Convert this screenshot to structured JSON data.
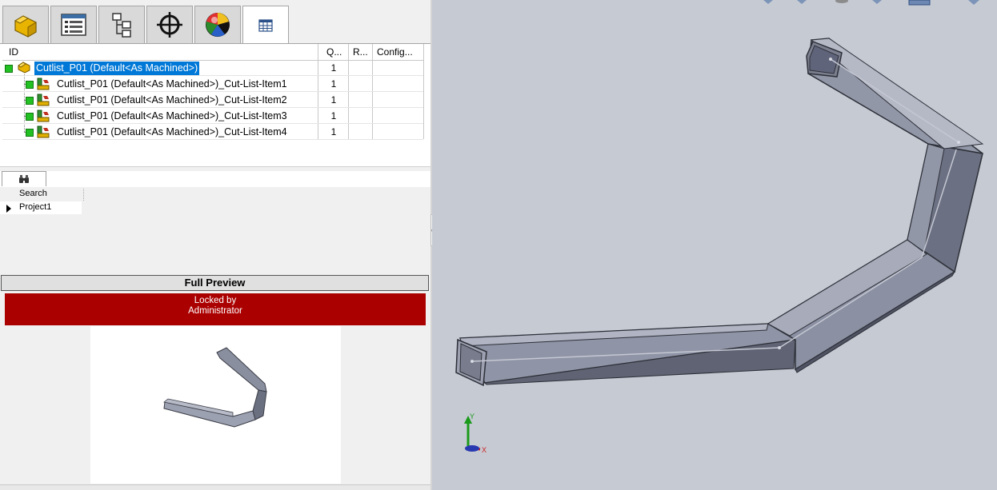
{
  "tabs": [
    {
      "name": "part-icon",
      "active": false
    },
    {
      "name": "property-list-icon",
      "active": false
    },
    {
      "name": "tree-structure-icon",
      "active": false
    },
    {
      "name": "target-crosshair-icon",
      "active": false
    },
    {
      "name": "appearance-sphere-icon",
      "active": false
    },
    {
      "name": "grid-table-icon",
      "active": true
    }
  ],
  "cutlist": {
    "columns": {
      "id": "ID",
      "qty": "Q...",
      "r": "R...",
      "config": "Config..."
    },
    "rows": [
      {
        "label": "Cutlist_P01 (Default<As Machined>)",
        "qty": "1",
        "selected": true
      },
      {
        "label": "Cutlist_P01 (Default<As Machined>)_Cut-List-Item1",
        "qty": "1"
      },
      {
        "label": "Cutlist_P01 (Default<As Machined>)_Cut-List-Item2",
        "qty": "1"
      },
      {
        "label": "Cutlist_P01 (Default<As Machined>)_Cut-List-Item3",
        "qty": "1"
      },
      {
        "label": "Cutlist_P01 (Default<As Machined>)_Cut-List-Item4",
        "qty": "1"
      }
    ]
  },
  "search": {
    "header": "Search",
    "row_value": "Project1"
  },
  "preview": {
    "title": "Full Preview",
    "locked_line1": "Locked by",
    "locked_line2": "Administrator"
  },
  "triad": {
    "y_label": "Y",
    "x_label": "X"
  },
  "colors": {
    "selection": "#0078d7",
    "locked_banner": "#ab0000",
    "status_green": "#22c022",
    "viewport_bg": "#c6cad3"
  }
}
